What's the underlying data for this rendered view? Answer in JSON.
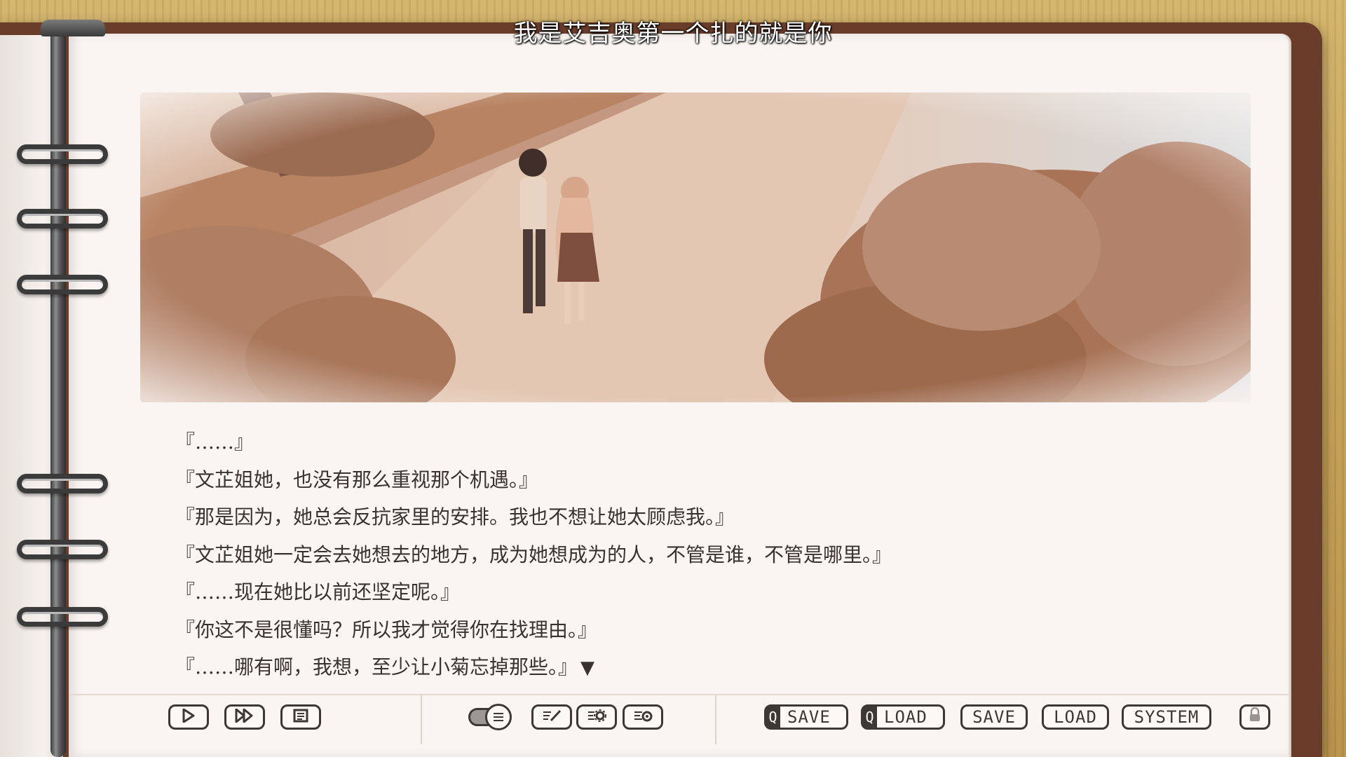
{
  "subtitle": "我是艾吉奥第一个扎的就是你",
  "dialogue": {
    "lines": [
      "『……』",
      "『文芷姐她，也没有那么重视那个机遇。』",
      "『那是因为，她总会反抗家里的安排。我也不想让她太顾虑我。』",
      "『文芷姐她一定会去她想去的地方，成为她想成为的人，不管是谁，不管是哪里。』",
      "『……现在她比以前还坚定呢。』",
      "『你这不是很懂吗？所以我才觉得你在找理由。』",
      "『……哪有啊，我想，至少让小菊忘掉那些。』"
    ],
    "next_indicator": "▼"
  },
  "toolbar": {
    "play_icon": "play-icon",
    "skip_icon": "fast-forward-icon",
    "log_icon": "log-icon",
    "text_toggle_icon": "text-window-toggle-icon",
    "text_settings_icon": "text-settings-icon",
    "config_icon": "config-icon",
    "voice_icon": "voice-replay-icon",
    "qsave_tag": "Q",
    "qsave_label": "SAVE",
    "qload_tag": "Q",
    "qload_label": "LOAD",
    "save_label": "SAVE",
    "load_label": "LOAD",
    "system_label": "SYSTEM",
    "lock_icon": "lock-icon"
  },
  "colors": {
    "page": "#faf5f2",
    "cover": "#6a3d2a",
    "ink": "#3a3230",
    "sepia": "#c79a7c"
  }
}
